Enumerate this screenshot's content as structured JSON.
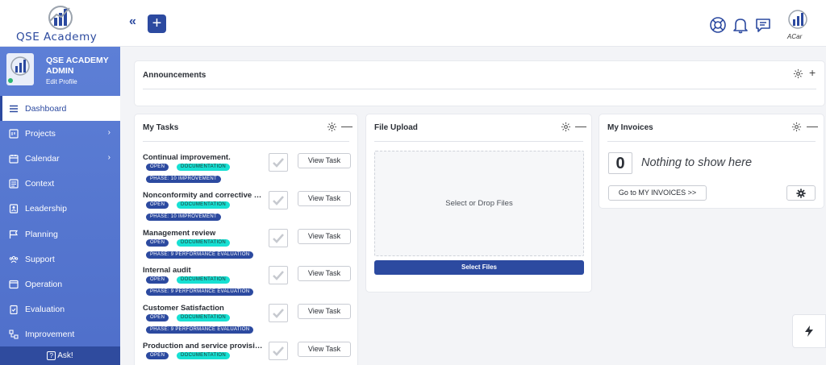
{
  "brand": {
    "name": "QSE Academy",
    "accent": "#2c4aa0",
    "sidebar_color": "#5674d1",
    "avatar_caption": "ACar"
  },
  "header": {
    "collapse_label": "«",
    "add_label": "+",
    "icons": [
      "lifebuoy-icon",
      "bell-icon",
      "chat-icon",
      "user-avatar"
    ]
  },
  "profile": {
    "name_line1": "QSE ACADEMY",
    "name_line2": "ADMIN",
    "edit": "Edit Profile"
  },
  "sidebar": {
    "items": [
      {
        "label": "Dashboard",
        "icon": "menu-icon",
        "active": true
      },
      {
        "label": "Projects",
        "icon": "projects-icon",
        "chevron": true
      },
      {
        "label": "Calendar",
        "icon": "calendar-icon",
        "chevron": true
      },
      {
        "label": "Context",
        "icon": "context-icon"
      },
      {
        "label": "Leadership",
        "icon": "leadership-icon"
      },
      {
        "label": "Planning",
        "icon": "planning-icon"
      },
      {
        "label": "Support",
        "icon": "support-icon"
      },
      {
        "label": "Operation",
        "icon": "operation-icon"
      },
      {
        "label": "Evaluation",
        "icon": "evaluation-icon"
      },
      {
        "label": "Improvement",
        "icon": "improvement-icon"
      }
    ],
    "ask": "Ask!",
    "ask_icon": "?"
  },
  "announcements": {
    "title": "Announcements"
  },
  "tasks": {
    "title": "My Tasks",
    "items": [
      {
        "title": "Continual improvement.",
        "status": "OPEN",
        "type": "DOCUMENTATION",
        "phase": "PHASE: 10 IMPROVEMENT",
        "button": "View Task"
      },
      {
        "title": "Nonconformity and corrective a...",
        "status": "OPEN",
        "type": "DOCUMENTATION",
        "phase": "PHASE: 10 IMPROVEMENT",
        "button": "View Task"
      },
      {
        "title": "Management review",
        "status": "OPEN",
        "type": "DOCUMENTATION",
        "phase": "PHASE: 9 PERFORMANCE EVALUATION",
        "button": "View Task"
      },
      {
        "title": "Internal audit",
        "status": "OPEN",
        "type": "DOCUMENTATION",
        "phase": "PHASE: 9 PERFORMANCE EVALUATION",
        "button": "View Task"
      },
      {
        "title": "Customer Satisfaction",
        "status": "OPEN",
        "type": "DOCUMENTATION",
        "phase": "PHASE: 9 PERFORMANCE EVALUATION",
        "button": "View Task"
      },
      {
        "title": "Production and service provision",
        "status": "OPEN",
        "type": "DOCUMENTATION",
        "phase": "",
        "button": "View Task"
      }
    ]
  },
  "file_upload": {
    "title": "File Upload",
    "drop_text": "Select or Drop Files",
    "button": "Select Files"
  },
  "invoices": {
    "title": "My Invoices",
    "count": "0",
    "empty_text": "Nothing to show here",
    "button": "Go to MY INVOICES >>"
  }
}
